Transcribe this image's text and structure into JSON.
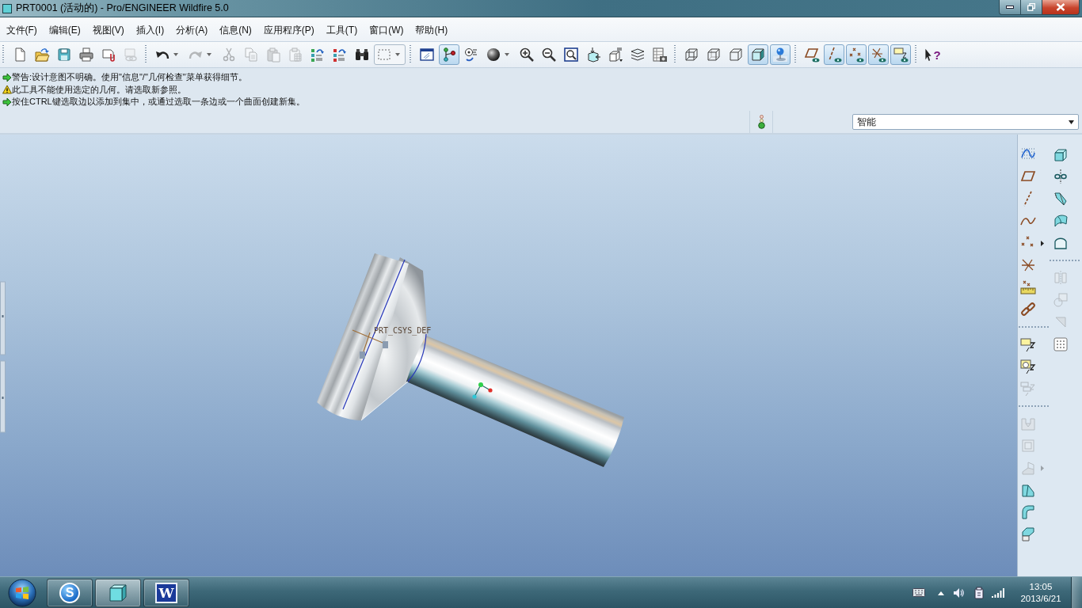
{
  "window": {
    "title": "PRT0001 (活动的) - Pro/ENGINEER Wildfire 5.0"
  },
  "menu": [
    "文件(F)",
    "编辑(E)",
    "视图(V)",
    "插入(I)",
    "分析(A)",
    "信息(N)",
    "应用程序(P)",
    "工具(T)",
    "窗口(W)",
    "帮助(H)"
  ],
  "toolbar": [
    [
      {
        "kind": "new",
        "pressed": false,
        "disabled": false,
        "dropdown": false
      },
      {
        "kind": "open",
        "pressed": false,
        "disabled": false,
        "dropdown": false
      },
      {
        "kind": "save",
        "pressed": false,
        "disabled": false,
        "dropdown": false
      },
      {
        "kind": "print",
        "pressed": false,
        "disabled": false,
        "dropdown": false
      },
      {
        "kind": "send",
        "pressed": false,
        "disabled": false,
        "dropdown": false
      },
      {
        "kind": "send-link",
        "pressed": false,
        "disabled": true,
        "dropdown": false
      }
    ],
    [
      {
        "kind": "undo",
        "pressed": false,
        "disabled": false,
        "dropdown": true
      },
      {
        "kind": "redo",
        "pressed": false,
        "disabled": true,
        "dropdown": true
      },
      {
        "kind": "cut",
        "pressed": false,
        "disabled": true,
        "dropdown": false
      },
      {
        "kind": "copy",
        "pressed": false,
        "disabled": true,
        "dropdown": false
      },
      {
        "kind": "paste",
        "pressed": false,
        "disabled": true,
        "dropdown": false
      },
      {
        "kind": "paste-special",
        "pressed": false,
        "disabled": true,
        "dropdown": false
      },
      {
        "kind": "regenerate",
        "pressed": false,
        "disabled": false,
        "dropdown": false
      },
      {
        "kind": "regen-manager",
        "pressed": false,
        "disabled": false,
        "dropdown": false
      },
      {
        "kind": "find",
        "pressed": false,
        "disabled": false,
        "dropdown": false
      },
      {
        "kind": "select-box",
        "pressed": false,
        "disabled": false,
        "dropdown": true
      }
    ],
    [
      {
        "kind": "repaint",
        "pressed": false,
        "disabled": false,
        "dropdown": false
      },
      {
        "kind": "spin-center",
        "pressed": true,
        "disabled": false,
        "dropdown": false
      },
      {
        "kind": "orient",
        "pressed": false,
        "disabled": false,
        "dropdown": false
      },
      {
        "kind": "shading-style",
        "pressed": false,
        "disabled": false,
        "dropdown": true
      },
      {
        "kind": "zoom-in",
        "pressed": false,
        "disabled": false,
        "dropdown": false
      },
      {
        "kind": "zoom-out",
        "pressed": false,
        "disabled": false,
        "dropdown": false
      },
      {
        "kind": "refit",
        "pressed": false,
        "disabled": false,
        "dropdown": false
      },
      {
        "kind": "reorient",
        "pressed": false,
        "disabled": false,
        "dropdown": false
      },
      {
        "kind": "saved-views",
        "pressed": false,
        "disabled": false,
        "dropdown": false
      },
      {
        "kind": "layers",
        "pressed": false,
        "disabled": false,
        "dropdown": false
      },
      {
        "kind": "view-manager",
        "pressed": false,
        "disabled": false,
        "dropdown": false
      }
    ],
    [
      {
        "kind": "wireframe",
        "pressed": false,
        "disabled": false,
        "dropdown": false
      },
      {
        "kind": "hidden-line",
        "pressed": false,
        "disabled": false,
        "dropdown": false
      },
      {
        "kind": "no-hidden",
        "pressed": false,
        "disabled": false,
        "dropdown": false
      },
      {
        "kind": "shading",
        "pressed": true,
        "disabled": false,
        "dropdown": false
      },
      {
        "kind": "realism",
        "pressed": true,
        "disabled": false,
        "dropdown": false
      }
    ],
    [
      {
        "kind": "plane-display",
        "pressed": false,
        "disabled": false,
        "dropdown": false
      },
      {
        "kind": "axis-display",
        "pressed": true,
        "disabled": false,
        "dropdown": false
      },
      {
        "kind": "point-display",
        "pressed": true,
        "disabled": false,
        "dropdown": false
      },
      {
        "kind": "csys-display",
        "pressed": true,
        "disabled": false,
        "dropdown": false
      },
      {
        "kind": "annotation-display",
        "pressed": true,
        "disabled": false,
        "dropdown": false
      }
    ],
    [
      {
        "kind": "help",
        "glyph": "?",
        "pressed": false,
        "disabled": false,
        "dropdown": false
      }
    ]
  ],
  "messages": [
    {
      "kind": "info",
      "text": "警告:设计意图不明确。使用\"信息\"/\"几何检查\"菜单获得细节。"
    },
    {
      "kind": "warning",
      "text": "此工具不能使用选定的几何。请选取新参照。"
    },
    {
      "kind": "info",
      "text": "按住CTRL键选取边以添加到集中，或通过选取一条边或一个曲面创建新集。"
    }
  ],
  "status": {
    "filter": "智能"
  },
  "model_view": {
    "csys_label": "PRT_CSYS_DEF"
  },
  "feature_toolbar": [
    [
      [
        {
          "kind": "sketch",
          "disabled": false,
          "flyout": false
        },
        {
          "kind": "plane",
          "disabled": false,
          "flyout": false
        },
        {
          "kind": "axis",
          "disabled": false,
          "flyout": false
        },
        {
          "kind": "curve",
          "disabled": false,
          "flyout": false
        },
        {
          "kind": "point",
          "disabled": false,
          "flyout": true
        },
        {
          "kind": "csys",
          "disabled": false,
          "flyout": false
        },
        {
          "kind": "analysis",
          "disabled": false,
          "flyout": false
        },
        {
          "kind": "chain",
          "disabled": false,
          "flyout": false
        }
      ],
      [
        {
          "kind": "note",
          "disabled": false,
          "flyout": false
        },
        {
          "kind": "note-model",
          "disabled": false,
          "flyout": false
        },
        {
          "kind": "note-set",
          "disabled": true,
          "flyout": false
        }
      ],
      [
        {
          "kind": "hole",
          "disabled": true,
          "flyout": false
        },
        {
          "kind": "shell",
          "disabled": true,
          "flyout": false
        },
        {
          "kind": "rib",
          "disabled": true,
          "flyout": true
        },
        {
          "kind": "draft",
          "disabled": false,
          "flyout": false
        },
        {
          "kind": "round",
          "disabled": false,
          "flyout": false
        },
        {
          "kind": "chamfer",
          "disabled": false,
          "flyout": false
        }
      ]
    ],
    [
      [
        {
          "kind": "extrude",
          "disabled": false,
          "flyout": false
        },
        {
          "kind": "revolve",
          "disabled": false,
          "flyout": false
        },
        {
          "kind": "sweep",
          "disabled": false,
          "flyout": false
        },
        {
          "kind": "swept-blend",
          "disabled": false,
          "flyout": false
        },
        {
          "kind": "boundary",
          "disabled": false,
          "flyout": false
        }
      ],
      [
        {
          "kind": "mirror",
          "disabled": true,
          "flyout": false
        },
        {
          "kind": "merge",
          "disabled": true,
          "flyout": false
        },
        {
          "kind": "trim",
          "disabled": true,
          "flyout": false
        },
        {
          "kind": "pattern",
          "disabled": false,
          "flyout": false
        }
      ]
    ]
  ],
  "taskbar": {
    "apps": [
      {
        "kind": "input-method",
        "glyph": "S",
        "selected": false
      },
      {
        "kind": "cad",
        "selected": true
      },
      {
        "kind": "document",
        "glyph": "W",
        "selected": false
      }
    ],
    "time": "13:05",
    "date": "2013/6/21"
  }
}
